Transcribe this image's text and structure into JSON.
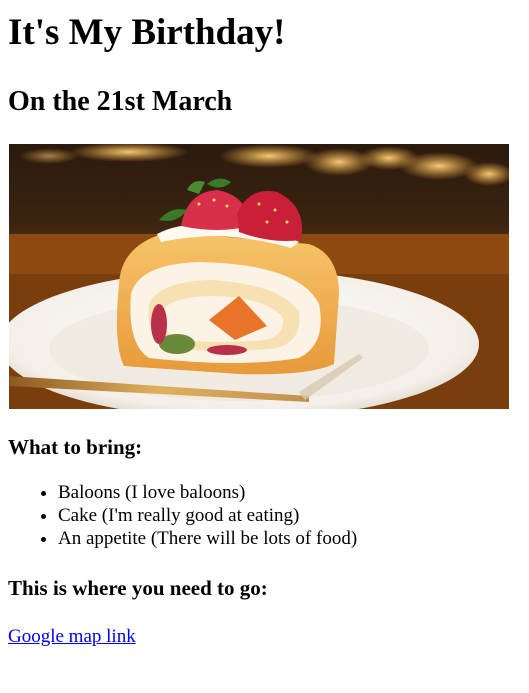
{
  "page": {
    "title": "It's My Birthday!",
    "subtitle": "On the 21st March"
  },
  "image": {
    "subject": "slice of roll cake with strawberries on a white plate"
  },
  "bring": {
    "heading": "What to bring:",
    "items": [
      {
        "label": "Baloons (I love baloons)"
      },
      {
        "label": "Cake (I'm really good at eating)"
      },
      {
        "label": "An appetite (There will be lots of food)"
      }
    ]
  },
  "directions": {
    "heading": "This is where you need to go:",
    "link_label": "Google map link"
  },
  "colors": {
    "link": "#0000ee",
    "text": "#000000"
  }
}
